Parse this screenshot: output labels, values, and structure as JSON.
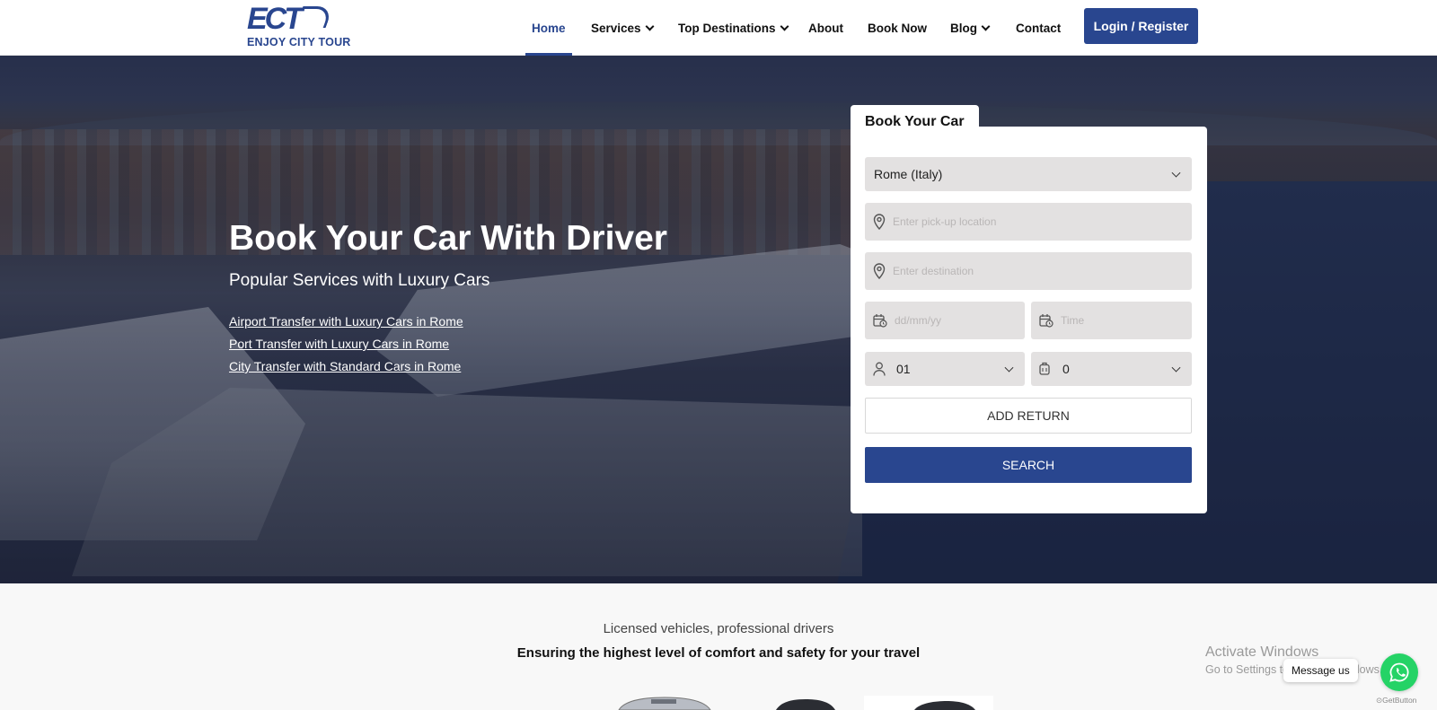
{
  "brand": {
    "mark": "ECT",
    "name": "ENJOY CITY TOUR",
    "color": "#29468f"
  },
  "nav": {
    "items": [
      {
        "label": "Home",
        "active": true,
        "dropdown": false
      },
      {
        "label": "Services",
        "active": false,
        "dropdown": true
      },
      {
        "label": "Top Destinations",
        "active": false,
        "dropdown": true
      },
      {
        "label": "About",
        "active": false,
        "dropdown": false
      },
      {
        "label": "Book Now",
        "active": false,
        "dropdown": false
      },
      {
        "label": "Blog",
        "active": false,
        "dropdown": true
      },
      {
        "label": "Contact",
        "active": false,
        "dropdown": false
      }
    ],
    "login_label": "Login / Register"
  },
  "hero": {
    "title": "Book Your Car With Driver",
    "subtitle": "Popular Services with Luxury Cars",
    "links": [
      "Airport Transfer with Luxury Cars in Rome",
      "Port Transfer with Luxury Cars in Rome",
      "City Transfer with Standard Cars in Rome"
    ]
  },
  "booking": {
    "tab_label": "Book Your Car",
    "city_select": "Rome (Italy)",
    "pickup_placeholder": "Enter pick-up location",
    "destination_placeholder": "Enter destination",
    "date_placeholder": "dd/mm/yy",
    "time_placeholder": "Time",
    "passengers": "01",
    "luggage": "0",
    "add_return_label": "ADD RETURN",
    "search_label": "SEARCH"
  },
  "section": {
    "tagline": "Licensed vehicles, professional drivers",
    "heading": "Ensuring the highest level of comfort and safety for your travel"
  },
  "overlay": {
    "activate_title": "Activate Windows",
    "activate_sub": "Go to Settings to activate Windows.",
    "message_label": "Message us",
    "getbutton_label": "GetButton",
    "whatsapp_color": "#25d366"
  }
}
